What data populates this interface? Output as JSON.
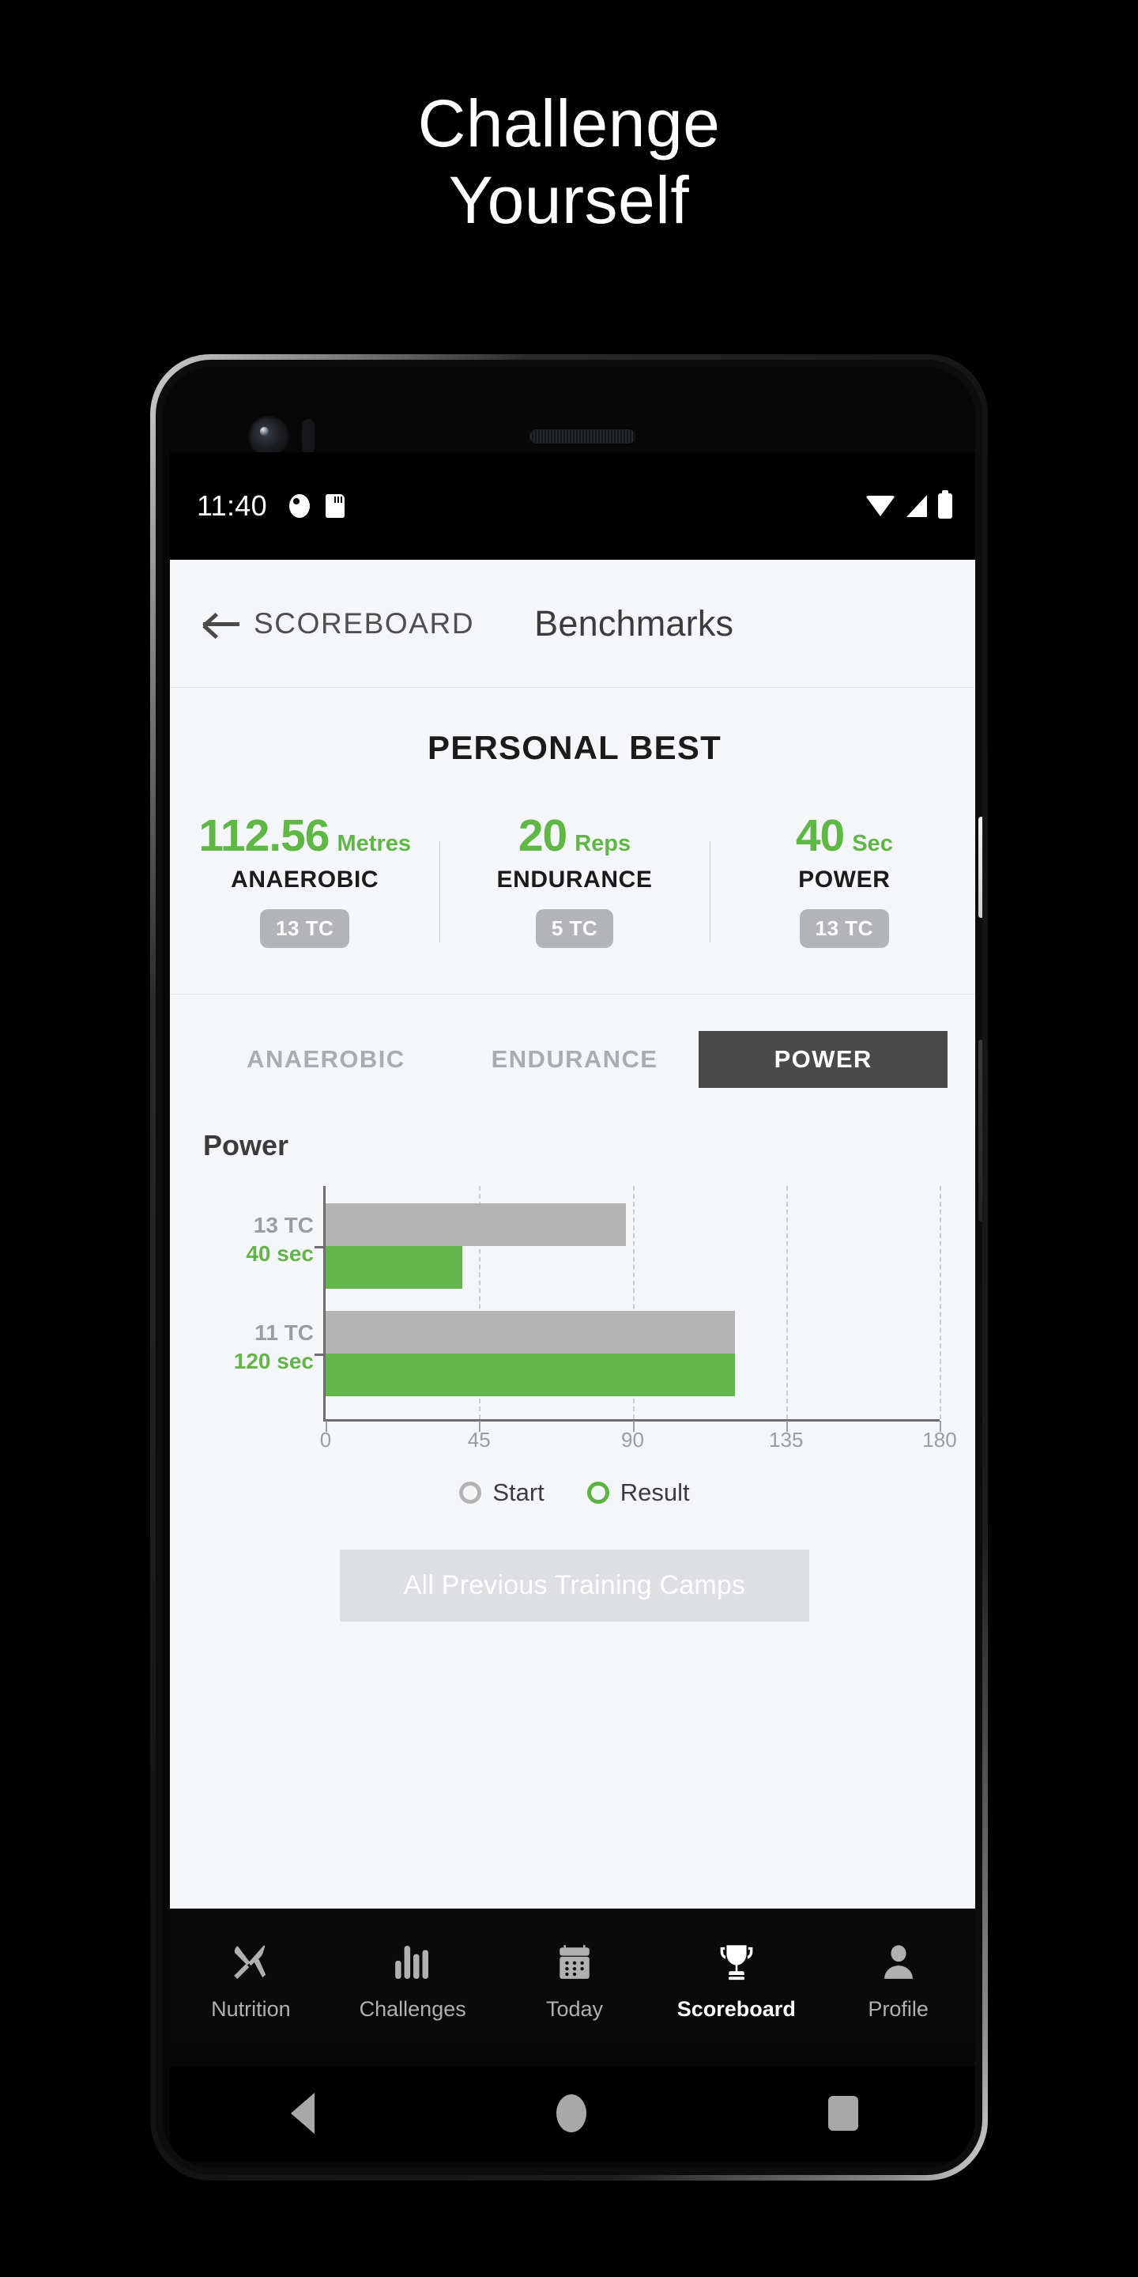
{
  "headline": {
    "line1": "Challenge",
    "line2": "Yourself"
  },
  "status_bar": {
    "time": "11:40",
    "icons": [
      "alarm-icon",
      "sd-card-icon",
      "wifi-icon",
      "signal-icon",
      "battery-icon"
    ]
  },
  "app_header": {
    "back_icon": "back-arrow-icon",
    "back_label": "SCOREBOARD",
    "title": "Benchmarks"
  },
  "personal_best": {
    "title": "PERSONAL BEST",
    "items": [
      {
        "value": "112.56",
        "unit": "Metres",
        "category": "ANAEROBIC",
        "badge": "13 TC"
      },
      {
        "value": "20",
        "unit": "Reps",
        "category": "ENDURANCE",
        "badge": "5 TC"
      },
      {
        "value": "40",
        "unit": "Sec",
        "category": "POWER",
        "badge": "13 TC"
      }
    ]
  },
  "tabs": [
    {
      "label": "ANAEROBIC",
      "active": false
    },
    {
      "label": "ENDURANCE",
      "active": false
    },
    {
      "label": "POWER",
      "active": true
    }
  ],
  "chart_section": {
    "title": "Power",
    "legend": [
      {
        "label": "Start",
        "color": "#b3b3b3"
      },
      {
        "label": "Result",
        "color": "#5cb53f"
      }
    ]
  },
  "chart_data": {
    "type": "bar",
    "orientation": "horizontal",
    "title": "Power",
    "xlabel": "",
    "ylabel": "",
    "xlim": [
      0,
      180
    ],
    "xticks": [
      0,
      45,
      90,
      135,
      180
    ],
    "grid": true,
    "legend_position": "bottom",
    "categories": [
      "13 TC",
      "11 TC"
    ],
    "category_sublabels": [
      "40 sec",
      "120 sec"
    ],
    "series": [
      {
        "name": "Start",
        "color": "#b3b3b3",
        "values": [
          88,
          120
        ]
      },
      {
        "name": "Result",
        "color": "#64b44b",
        "values": [
          40,
          120
        ]
      }
    ]
  },
  "cta": {
    "label": "All Previous Training Camps"
  },
  "bottom_nav": [
    {
      "label": "Nutrition",
      "icon": "cutlery-icon",
      "active": false
    },
    {
      "label": "Challenges",
      "icon": "bar-chart-icon",
      "active": false
    },
    {
      "label": "Today",
      "icon": "calendar-icon",
      "active": false
    },
    {
      "label": "Scoreboard",
      "icon": "trophy-icon",
      "active": true
    },
    {
      "label": "Profile",
      "icon": "person-icon",
      "active": true
    }
  ],
  "android_nav": [
    {
      "name": "back",
      "icon": "triangle-back-icon"
    },
    {
      "name": "home",
      "icon": "circle-home-icon"
    },
    {
      "name": "recents",
      "icon": "square-recents-icon"
    }
  ],
  "colors": {
    "green": "#5fb746",
    "bar_green": "#64b44b",
    "grey": "#b3b3b3",
    "dark": "#4a4a4a",
    "bg": "#f4f6f9"
  }
}
